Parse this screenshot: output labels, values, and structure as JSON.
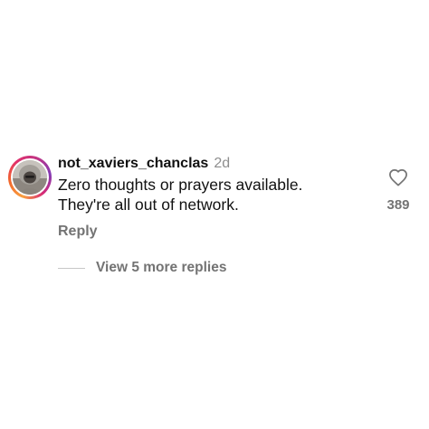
{
  "comment": {
    "username": "not_xaviers_chanclas",
    "time": "2d",
    "text_line1": "Zero thoughts or prayers available.",
    "text_line2": "They're all out of network.",
    "reply_label": "Reply",
    "like_count": "389",
    "view_replies_label": "View 5 more replies"
  },
  "icons": {
    "like": "heart-outline-icon"
  },
  "colors": {
    "username": "#111111",
    "secondary_text": "#737373",
    "timestamp": "#8e8e8e",
    "story_ring": [
      "#f9a03f",
      "#e1306c",
      "#833ab4"
    ]
  }
}
